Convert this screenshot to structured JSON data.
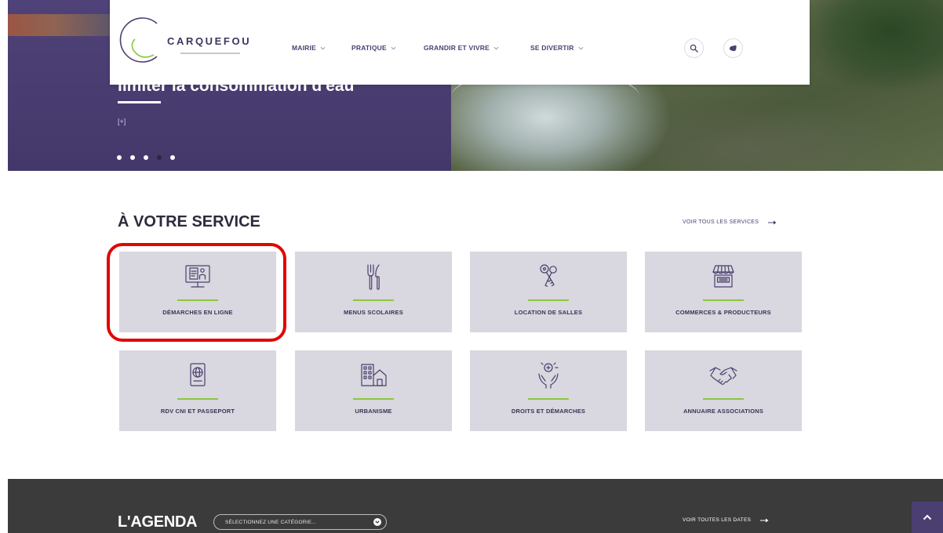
{
  "colors": {
    "brand_purple": "#4b3f72",
    "accent_green": "#8cc63f",
    "card_bg": "#d9d7df",
    "footer_bg": "#3b3b3c",
    "highlight_red": "#e10600"
  },
  "header": {
    "logo_text": "CARQUEFOU",
    "logo_icon": "carquefou-logo-icon",
    "nav": [
      {
        "label": "MAIRIE",
        "icon": "chevron-down-icon"
      },
      {
        "label": "PRATIQUE",
        "icon": "chevron-down-icon"
      },
      {
        "label": "GRANDIR ET VIVRE",
        "icon": "chevron-down-icon"
      },
      {
        "label": "SE DIVERTIR",
        "icon": "chevron-down-icon"
      }
    ],
    "actions": [
      {
        "icon": "search-icon"
      },
      {
        "icon": "hand-icon"
      }
    ]
  },
  "hero": {
    "title": "limiter la consommation d'eau",
    "more_link": "[+]",
    "slide_count": 5,
    "active_slide": 4
  },
  "services": {
    "title": "À VOTRE SERVICE",
    "see_all": "VOIR TOUS LES SERVICES",
    "see_all_icon": "arrow-right-icon",
    "cards": [
      {
        "label": "DÉMARCHES EN LIGNE",
        "icon": "computer-form-icon"
      },
      {
        "label": "MENUS SCOLAIRES",
        "icon": "cutlery-icon"
      },
      {
        "label": "LOCATION DE SALLES",
        "icon": "keys-icon"
      },
      {
        "label": "COMMERCES & PRODUCTEURS",
        "icon": "storefront-icon"
      },
      {
        "label": "RDV CNI ET PASSEPORT",
        "icon": "passport-icon"
      },
      {
        "label": "URBANISME",
        "icon": "buildings-icon"
      },
      {
        "label": "DROITS ET DÉMARCHES",
        "icon": "hands-icon"
      },
      {
        "label": "ANNUAIRE ASSOCIATIONS",
        "icon": "handshake-icon"
      }
    ]
  },
  "agenda": {
    "title": "L'AGENDA",
    "category_select": "SÉLECTIONNEZ UNE CATÉGORIE...",
    "see_all": "VOIR TOUTES LES DATES",
    "see_all_icon": "arrow-right-icon"
  },
  "scroll_top": {
    "icon": "chevron-up-icon"
  }
}
